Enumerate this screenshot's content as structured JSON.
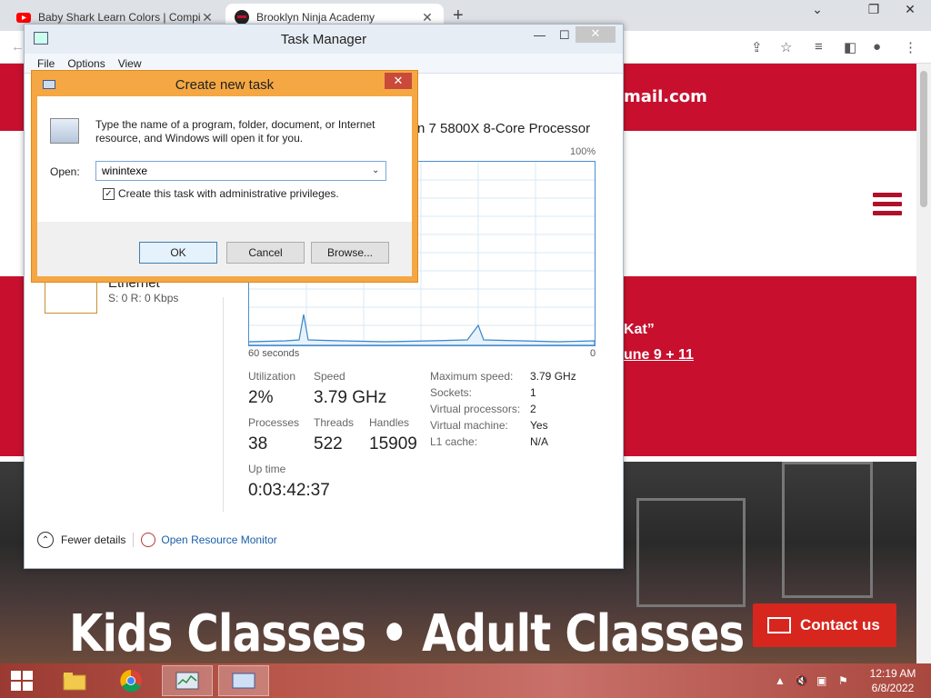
{
  "browser": {
    "tabs": [
      {
        "title": "Baby Shark Learn Colors | Compil"
      },
      {
        "title": "Brooklyn Ninja Academy"
      }
    ]
  },
  "website": {
    "email_fragment": "mail.com",
    "promo_line1": "Kat”",
    "promo_line2": "une 9 + 11",
    "hero_text": "Kids Classes • Adult Classes • Birthdays •",
    "contact_label": "Contact us",
    "accent_color": "#c8102e"
  },
  "task_manager": {
    "title": "Task Manager",
    "menu": [
      "File",
      "Options",
      "View"
    ],
    "cpu_name": "n 7 5800X 8-Core Processor",
    "graph_max": "100%",
    "axis_left": "60 seconds",
    "axis_right": "0",
    "ethernet": {
      "name": "Ethernet",
      "value": "S: 0 R: 0 Kbps"
    },
    "stats": {
      "utilization_label": "Utilization",
      "utilization": "2%",
      "speed_label": "Speed",
      "speed": "3.79 GHz",
      "processes_label": "Processes",
      "processes": "38",
      "threads_label": "Threads",
      "threads": "522",
      "handles_label": "Handles",
      "handles": "15909",
      "uptime_label": "Up time",
      "uptime": "0:03:42:37"
    },
    "specs": [
      {
        "label": "Maximum speed:",
        "value": "3.79 GHz"
      },
      {
        "label": "Sockets:",
        "value": "1"
      },
      {
        "label": "Virtual processors:",
        "value": "2"
      },
      {
        "label": "Virtual machine:",
        "value": "Yes"
      },
      {
        "label": "L1 cache:",
        "value": "N/A"
      }
    ],
    "footer": {
      "fewer_details": "Fewer details",
      "resource_monitor": "Open Resource Monitor"
    }
  },
  "dialog": {
    "title": "Create new task",
    "description": "Type the name of a program, folder, document, or Internet resource, and Windows will open it for you.",
    "open_label": "Open:",
    "open_value": "winintexe",
    "admin_checkbox_label": "Create this task with administrative privileges.",
    "admin_checked": true,
    "ok": "OK",
    "cancel": "Cancel",
    "browse": "Browse..."
  },
  "taskbar": {
    "clock_time": "12:19 AM",
    "clock_date": "6/8/2022"
  }
}
